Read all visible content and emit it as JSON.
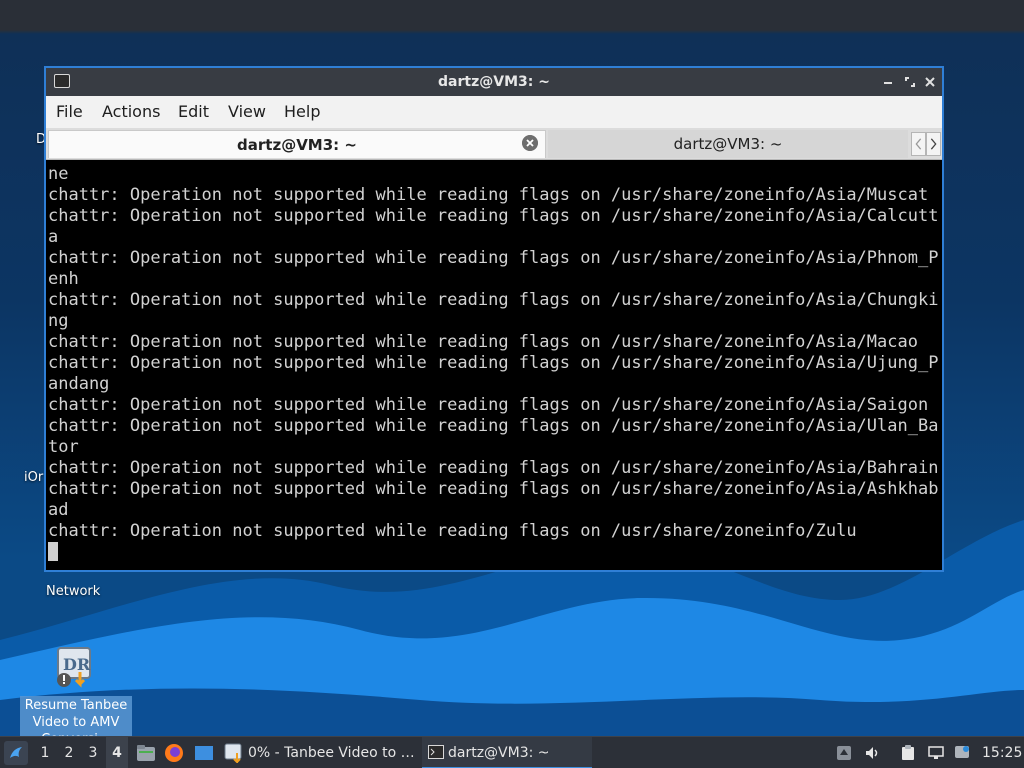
{
  "desktop": {
    "partial_labels": [
      "D",
      "iOr"
    ],
    "network_label": "Network",
    "tanbee_icon_caption": "Resume Tanbee Video to AMV Conversi…"
  },
  "window": {
    "title": "dartz@VM3: ~",
    "menu": [
      "File",
      "Actions",
      "Edit",
      "View",
      "Help"
    ],
    "tabs": [
      {
        "label": "dartz@VM3: ~",
        "active": true
      },
      {
        "label": "dartz@VM3: ~",
        "active": false
      }
    ],
    "output_lines": [
      "ne",
      "chattr: Operation not supported while reading flags on /usr/share/zoneinfo/Asia/Muscat",
      "chattr: Operation not supported while reading flags on /usr/share/zoneinfo/Asia/Calcutt",
      "a",
      "chattr: Operation not supported while reading flags on /usr/share/zoneinfo/Asia/Phnom_P",
      "enh",
      "chattr: Operation not supported while reading flags on /usr/share/zoneinfo/Asia/Chungki",
      "ng",
      "chattr: Operation not supported while reading flags on /usr/share/zoneinfo/Asia/Macao",
      "chattr: Operation not supported while reading flags on /usr/share/zoneinfo/Asia/Ujung_P",
      "andang",
      "chattr: Operation not supported while reading flags on /usr/share/zoneinfo/Asia/Saigon",
      "chattr: Operation not supported while reading flags on /usr/share/zoneinfo/Asia/Ulan_Ba",
      "tor",
      "chattr: Operation not supported while reading flags on /usr/share/zoneinfo/Asia/Bahrain",
      "chattr: Operation not supported while reading flags on /usr/share/zoneinfo/Asia/Ashkhab",
      "ad",
      "chattr: Operation not supported while reading flags on /usr/share/zoneinfo/Zulu"
    ]
  },
  "taskbar": {
    "workspaces": [
      "1",
      "2",
      "3",
      "4"
    ],
    "active_workspace": "4",
    "tasks": [
      {
        "label": "0% - Tanbee Video to …",
        "icon": "tanbee-app-icon"
      },
      {
        "label": "dartz@VM3: ~",
        "icon": "terminal-icon"
      }
    ],
    "clock": "15:25"
  },
  "colors": {
    "window_border": "#2f7fd6",
    "titlebar": "#383c43",
    "terminal_bg": "#000000",
    "terminal_fg": "#d2d2d2",
    "taskbar": "#2c3038"
  }
}
